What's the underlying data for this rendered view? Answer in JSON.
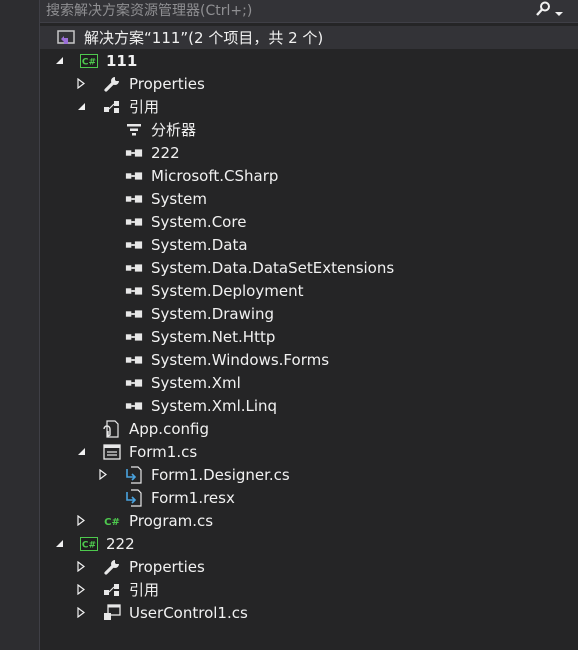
{
  "search": {
    "placeholder": "搜索解决方案资源管理器(Ctrl+;)"
  },
  "tree": {
    "solution_label": "解决方案“111”(2 个项目，共 2 个)",
    "project_111": {
      "label": "111",
      "properties": "Properties",
      "references_label": "引用",
      "references": [
        "分析器",
        "222",
        "Microsoft.CSharp",
        "System",
        "System.Core",
        "System.Data",
        "System.Data.DataSetExtensions",
        "System.Deployment",
        "System.Drawing",
        "System.Net.Http",
        "System.Windows.Forms",
        "System.Xml",
        "System.Xml.Linq"
      ],
      "app_config": "App.config",
      "form1": "Form1.cs",
      "form1_designer": "Form1.Designer.cs",
      "form1_resx": "Form1.resx",
      "program": "Program.cs"
    },
    "project_222": {
      "label": "222",
      "properties": "Properties",
      "references_label": "引用",
      "usercontrol": "UserControl1.cs"
    }
  },
  "colors": {
    "background": "#252526",
    "text": "#f1f1f1",
    "csharp_green": "#4ec94e",
    "solution_purple": "#9b6fd8",
    "selected_row": "#333337"
  }
}
